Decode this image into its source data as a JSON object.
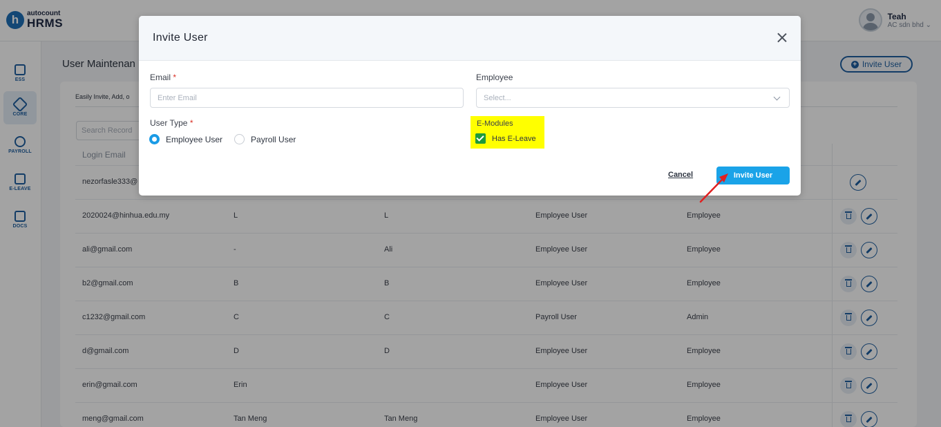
{
  "brand": {
    "small": "autocount",
    "big": "HRMS",
    "mark": "h",
    "color": "#1e6fb8"
  },
  "user": {
    "name": "Teah",
    "company": "AC sdn bhd"
  },
  "sidebar": {
    "items": [
      {
        "label": "ESS",
        "icon": "ess-icon"
      },
      {
        "label": "CORE",
        "icon": "core-icon",
        "active": true
      },
      {
        "label": "PAYROLL",
        "icon": "payroll-icon"
      },
      {
        "label": "E-LEAVE",
        "icon": "calendar-icon"
      },
      {
        "label": "DOCS",
        "icon": "docs-icon"
      }
    ]
  },
  "page": {
    "title": "User Maintenan",
    "invite_button": "Invite User",
    "description": "Easily Invite, Add, o",
    "search_placeholder": "Search Record",
    "column_login_email": "Login Email"
  },
  "table": {
    "rows": [
      {
        "email": "nezorfasle333@",
        "c2": "",
        "c3": "",
        "type": "",
        "role": ""
      },
      {
        "email": "2020024@hinhua.edu.my",
        "c2": "L",
        "c3": "L",
        "type": "Employee User",
        "role": "Employee"
      },
      {
        "email": "ali@gmail.com",
        "c2": "-",
        "c3": "Ali",
        "type": "Employee User",
        "role": "Employee"
      },
      {
        "email": "b2@gmail.com",
        "c2": "B",
        "c3": "B",
        "type": "Employee User",
        "role": "Employee"
      },
      {
        "email": "c1232@gmail.com",
        "c2": "C",
        "c3": "C",
        "type": "Payroll User",
        "role": "Admin"
      },
      {
        "email": "d@gmail.com",
        "c2": "D",
        "c3": "D",
        "type": "Employee User",
        "role": "Employee"
      },
      {
        "email": "erin@gmail.com",
        "c2": "Erin",
        "c3": "",
        "type": "Employee User",
        "role": "Employee"
      },
      {
        "email": "meng@gmail.com",
        "c2": "Tan Meng",
        "c3": "Tan Meng",
        "type": "Employee User",
        "role": "Employee"
      }
    ]
  },
  "modal": {
    "title": "Invite User",
    "email_label": "Email",
    "email_required": "*",
    "email_placeholder": "Enter Email",
    "employee_label": "Employee",
    "employee_placeholder": "Select...",
    "user_type_label": "User Type",
    "user_type_required": "*",
    "user_type_options": [
      {
        "label": "Employee User",
        "selected": true
      },
      {
        "label": "Payroll User",
        "selected": false
      }
    ],
    "emodules_label": "E-Modules",
    "has_eleave_label": "Has E-Leave",
    "has_eleave_checked": true,
    "cancel_label": "Cancel",
    "invite_label": "Invite User"
  },
  "colors": {
    "accent": "#1aa3e8",
    "primary": "#1e5fa0",
    "highlight": "#ffff00",
    "check": "#1e9a3c",
    "annotation_arrow": "#e02020"
  }
}
